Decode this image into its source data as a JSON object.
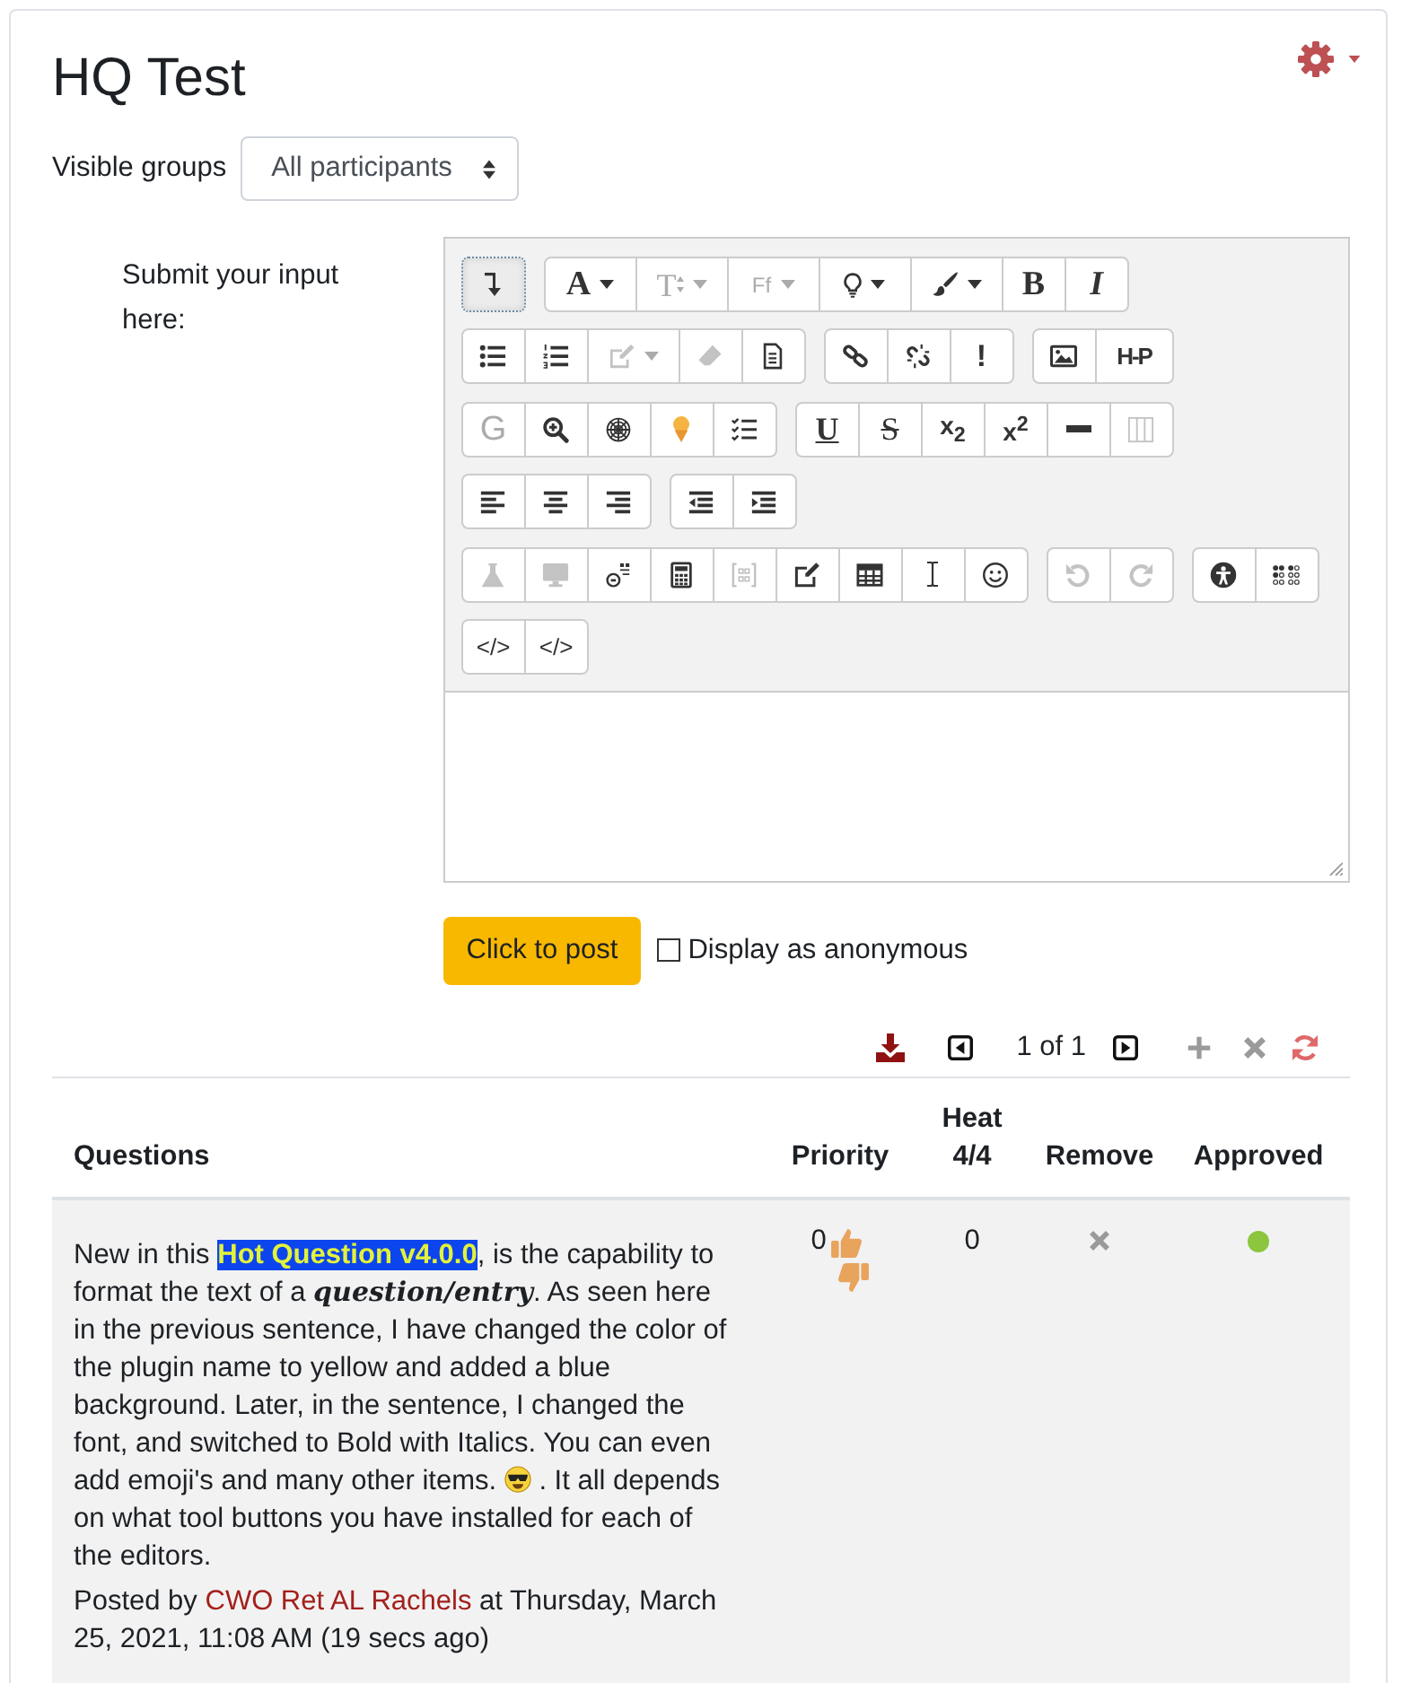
{
  "page": {
    "title": "HQ Test"
  },
  "groups_filter": {
    "label": "Visible groups",
    "value": "All participants"
  },
  "editor": {
    "label": "Submit your input here:",
    "toggle": {
      "focused": true
    },
    "rows": [
      {
        "groups": [
          {
            "buttons": [
              {
                "kind": "fontcolor",
                "text": "A",
                "disabled": false
              },
              {
                "kind": "fontsize",
                "text": "T",
                "disabled": true
              },
              {
                "kind": "fontfamily",
                "text": "Ff",
                "disabled": true
              },
              {
                "kind": "bulb",
                "disabled": false
              },
              {
                "kind": "brush",
                "disabled": false
              },
              {
                "kind": "bold",
                "text": "B",
                "disabled": false
              },
              {
                "kind": "italic",
                "text": "I",
                "disabled": false
              }
            ]
          }
        ]
      },
      {
        "groups": [
          {
            "buttons": [
              {
                "kind": "bullets",
                "disabled": false
              },
              {
                "kind": "numbered",
                "disabled": false
              },
              {
                "kind": "edit",
                "disabled": true
              },
              {
                "kind": "eraser",
                "disabled": true
              },
              {
                "kind": "paste",
                "disabled": false
              }
            ]
          },
          {
            "buttons": [
              {
                "kind": "link",
                "disabled": false
              },
              {
                "kind": "unlink",
                "disabled": false
              },
              {
                "kind": "alert",
                "text": "!",
                "disabled": false
              }
            ]
          },
          {
            "buttons": [
              {
                "kind": "image",
                "disabled": false
              },
              {
                "kind": "logo",
                "text": "H-P",
                "disabled": false
              }
            ]
          }
        ]
      },
      {
        "groups": [
          {
            "buttons": [
              {
                "kind": "letter",
                "text": "G",
                "disabled": true
              },
              {
                "kind": "zoom",
                "disabled": false
              },
              {
                "kind": "web",
                "disabled": false
              },
              {
                "kind": "icecream",
                "disabled": false
              },
              {
                "kind": "checklist",
                "disabled": false
              }
            ]
          },
          {
            "buttons": [
              {
                "kind": "underline",
                "text": "U",
                "disabled": false
              },
              {
                "kind": "strike",
                "text": "S",
                "disabled": false
              },
              {
                "kind": "subscript",
                "text": "x$_{2}$",
                "disabled": false
              },
              {
                "kind": "superscript",
                "text": "x$^{2}$",
                "disabled": false
              },
              {
                "kind": "rule",
                "disabled": false
              },
              {
                "kind": "columns",
                "disabled": true
              }
            ]
          }
        ]
      },
      {
        "groups": [
          {
            "buttons": [
              {
                "kind": "alignleft",
                "disabled": false
              },
              {
                "kind": "aligncenter",
                "disabled": false
              },
              {
                "kind": "alignright",
                "disabled": false
              }
            ]
          },
          {
            "buttons": [
              {
                "kind": "outdent",
                "disabled": false
              },
              {
                "kind": "indent",
                "disabled": false
              }
            ]
          }
        ]
      },
      {
        "groups": [
          {
            "buttons": [
              {
                "kind": "flask",
                "disabled": true
              },
              {
                "kind": "monitor",
                "disabled": true
              },
              {
                "kind": "formula",
                "disabled": false
              },
              {
                "kind": "calculator",
                "disabled": false
              },
              {
                "kind": "brackets",
                "disabled": true
              },
              {
                "kind": "editsquare",
                "disabled": false
              },
              {
                "kind": "table",
                "disabled": false
              },
              {
                "kind": "cursor",
                "disabled": false
              },
              {
                "kind": "smiley",
                "disabled": false
              }
            ]
          },
          {
            "buttons": [
              {
                "kind": "undo",
                "disabled": true
              },
              {
                "kind": "redo",
                "disabled": true
              }
            ]
          },
          {
            "buttons": [
              {
                "kind": "accessibility",
                "disabled": false
              },
              {
                "kind": "braille",
                "disabled": false
              }
            ]
          }
        ]
      },
      {
        "groups": [
          {
            "buttons": [
              {
                "kind": "code",
                "text": "</>",
                "disabled": false
              },
              {
                "kind": "code",
                "text": "</>",
                "disabled": false
              }
            ]
          }
        ]
      }
    ]
  },
  "post_button": "Click to post",
  "anonymous": {
    "label": "Display as anonymous",
    "checked": false
  },
  "pager": {
    "label": "1 of 1"
  },
  "table": {
    "columns": [
      "Questions",
      "Priority",
      "Heat 4/4",
      "Remove",
      "Approved"
    ],
    "rows": [
      {
        "question": [
          {
            "kind": "text",
            "text": "New in this "
          },
          {
            "kind": "highlight",
            "text": "Hot Question v4.0.0"
          },
          {
            "kind": "text",
            "text": ", is the capability to format the text of a "
          },
          {
            "kind": "bolditalic",
            "text": "question/entry"
          },
          {
            "kind": "text",
            "text": ". As seen here in the previous sentence, I have changed the color of the plugin name to yellow and added a blue background. Later, in the sentence, I changed the font, and switched to Bold with Italics. You can even add emoji's and many other items. "
          },
          {
            "kind": "emoji"
          },
          {
            "kind": "text",
            "text": " . It all depends on what tool buttons you have installed for each of the editors."
          }
        ],
        "posted": [
          {
            "kind": "text",
            "text": "Posted by "
          },
          {
            "kind": "link",
            "text": "CWO Ret AL Rachels"
          },
          {
            "kind": "text",
            "text": " at Thursday, March 25, 2021, 11:08 AM (19 secs ago)"
          }
        ],
        "priority": "0",
        "heat": "0",
        "approved": true
      }
    ]
  }
}
